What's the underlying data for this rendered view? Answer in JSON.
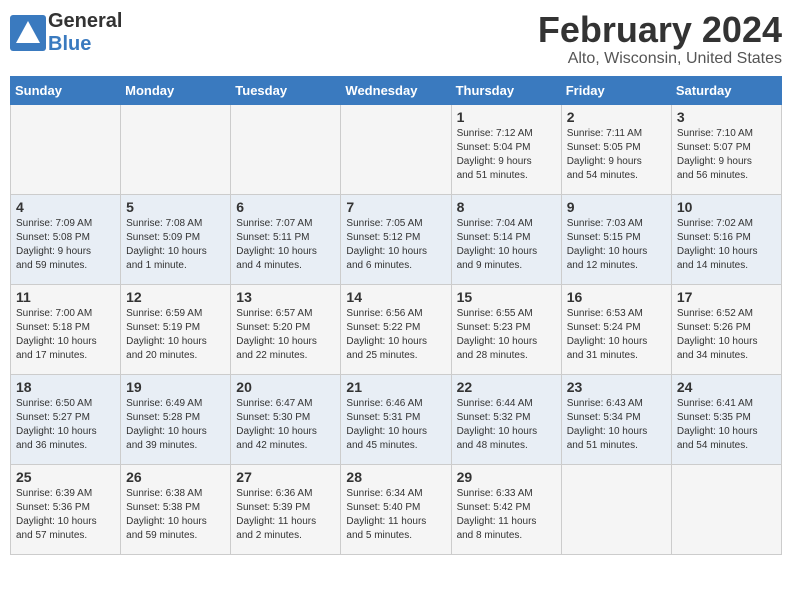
{
  "header": {
    "logo_general": "General",
    "logo_blue": "Blue",
    "month_title": "February 2024",
    "location": "Alto, Wisconsin, United States"
  },
  "days_of_week": [
    "Sunday",
    "Monday",
    "Tuesday",
    "Wednesday",
    "Thursday",
    "Friday",
    "Saturday"
  ],
  "weeks": [
    [
      {
        "number": "",
        "detail": ""
      },
      {
        "number": "",
        "detail": ""
      },
      {
        "number": "",
        "detail": ""
      },
      {
        "number": "",
        "detail": ""
      },
      {
        "number": "1",
        "detail": "Sunrise: 7:12 AM\nSunset: 5:04 PM\nDaylight: 9 hours\nand 51 minutes."
      },
      {
        "number": "2",
        "detail": "Sunrise: 7:11 AM\nSunset: 5:05 PM\nDaylight: 9 hours\nand 54 minutes."
      },
      {
        "number": "3",
        "detail": "Sunrise: 7:10 AM\nSunset: 5:07 PM\nDaylight: 9 hours\nand 56 minutes."
      }
    ],
    [
      {
        "number": "4",
        "detail": "Sunrise: 7:09 AM\nSunset: 5:08 PM\nDaylight: 9 hours\nand 59 minutes."
      },
      {
        "number": "5",
        "detail": "Sunrise: 7:08 AM\nSunset: 5:09 PM\nDaylight: 10 hours\nand 1 minute."
      },
      {
        "number": "6",
        "detail": "Sunrise: 7:07 AM\nSunset: 5:11 PM\nDaylight: 10 hours\nand 4 minutes."
      },
      {
        "number": "7",
        "detail": "Sunrise: 7:05 AM\nSunset: 5:12 PM\nDaylight: 10 hours\nand 6 minutes."
      },
      {
        "number": "8",
        "detail": "Sunrise: 7:04 AM\nSunset: 5:14 PM\nDaylight: 10 hours\nand 9 minutes."
      },
      {
        "number": "9",
        "detail": "Sunrise: 7:03 AM\nSunset: 5:15 PM\nDaylight: 10 hours\nand 12 minutes."
      },
      {
        "number": "10",
        "detail": "Sunrise: 7:02 AM\nSunset: 5:16 PM\nDaylight: 10 hours\nand 14 minutes."
      }
    ],
    [
      {
        "number": "11",
        "detail": "Sunrise: 7:00 AM\nSunset: 5:18 PM\nDaylight: 10 hours\nand 17 minutes."
      },
      {
        "number": "12",
        "detail": "Sunrise: 6:59 AM\nSunset: 5:19 PM\nDaylight: 10 hours\nand 20 minutes."
      },
      {
        "number": "13",
        "detail": "Sunrise: 6:57 AM\nSunset: 5:20 PM\nDaylight: 10 hours\nand 22 minutes."
      },
      {
        "number": "14",
        "detail": "Sunrise: 6:56 AM\nSunset: 5:22 PM\nDaylight: 10 hours\nand 25 minutes."
      },
      {
        "number": "15",
        "detail": "Sunrise: 6:55 AM\nSunset: 5:23 PM\nDaylight: 10 hours\nand 28 minutes."
      },
      {
        "number": "16",
        "detail": "Sunrise: 6:53 AM\nSunset: 5:24 PM\nDaylight: 10 hours\nand 31 minutes."
      },
      {
        "number": "17",
        "detail": "Sunrise: 6:52 AM\nSunset: 5:26 PM\nDaylight: 10 hours\nand 34 minutes."
      }
    ],
    [
      {
        "number": "18",
        "detail": "Sunrise: 6:50 AM\nSunset: 5:27 PM\nDaylight: 10 hours\nand 36 minutes."
      },
      {
        "number": "19",
        "detail": "Sunrise: 6:49 AM\nSunset: 5:28 PM\nDaylight: 10 hours\nand 39 minutes."
      },
      {
        "number": "20",
        "detail": "Sunrise: 6:47 AM\nSunset: 5:30 PM\nDaylight: 10 hours\nand 42 minutes."
      },
      {
        "number": "21",
        "detail": "Sunrise: 6:46 AM\nSunset: 5:31 PM\nDaylight: 10 hours\nand 45 minutes."
      },
      {
        "number": "22",
        "detail": "Sunrise: 6:44 AM\nSunset: 5:32 PM\nDaylight: 10 hours\nand 48 minutes."
      },
      {
        "number": "23",
        "detail": "Sunrise: 6:43 AM\nSunset: 5:34 PM\nDaylight: 10 hours\nand 51 minutes."
      },
      {
        "number": "24",
        "detail": "Sunrise: 6:41 AM\nSunset: 5:35 PM\nDaylight: 10 hours\nand 54 minutes."
      }
    ],
    [
      {
        "number": "25",
        "detail": "Sunrise: 6:39 AM\nSunset: 5:36 PM\nDaylight: 10 hours\nand 57 minutes."
      },
      {
        "number": "26",
        "detail": "Sunrise: 6:38 AM\nSunset: 5:38 PM\nDaylight: 10 hours\nand 59 minutes."
      },
      {
        "number": "27",
        "detail": "Sunrise: 6:36 AM\nSunset: 5:39 PM\nDaylight: 11 hours\nand 2 minutes."
      },
      {
        "number": "28",
        "detail": "Sunrise: 6:34 AM\nSunset: 5:40 PM\nDaylight: 11 hours\nand 5 minutes."
      },
      {
        "number": "29",
        "detail": "Sunrise: 6:33 AM\nSunset: 5:42 PM\nDaylight: 11 hours\nand 8 minutes."
      },
      {
        "number": "",
        "detail": ""
      },
      {
        "number": "",
        "detail": ""
      }
    ]
  ]
}
